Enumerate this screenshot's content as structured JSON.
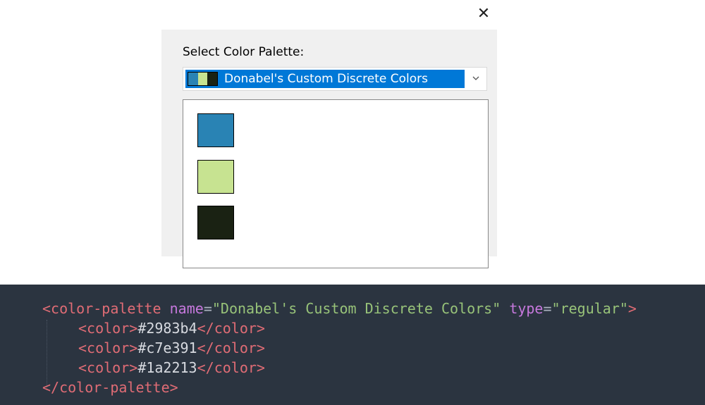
{
  "dialog": {
    "label": "Select Color Palette:",
    "selected_palette": "Donabel's Custom Discrete Colors",
    "close_glyph": "✕"
  },
  "palette": {
    "colors": [
      "#2983b4",
      "#c7e391",
      "#1a2213"
    ]
  },
  "code": {
    "open_tag": "color-palette",
    "name_attr": "name",
    "name_value": "\"Donabel's Custom Discrete Colors\"",
    "type_attr": "type",
    "type_value": "\"regular\"",
    "color_tag": "color",
    "colors": [
      "#2983b4",
      "#c7e391",
      "#1a2213"
    ],
    "close_tag": "/color-palette"
  },
  "icons": {
    "close": "close-icon",
    "chevron": "chevron-down-icon"
  }
}
